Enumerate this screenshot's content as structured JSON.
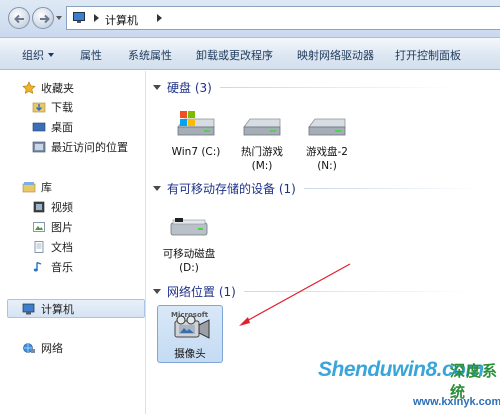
{
  "address": {
    "crumb": "计算机"
  },
  "toolbar": {
    "organize": "组织",
    "properties": "属性",
    "system_properties": "系统属性",
    "uninstall": "卸载或更改程序",
    "map_drive": "映射网络驱动器",
    "control_panel": "打开控制面板"
  },
  "nav": {
    "favorites": "收藏夹",
    "downloads": "下载",
    "desktop": "桌面",
    "recent": "最近访问的位置",
    "libraries": "库",
    "videos": "视频",
    "pictures": "图片",
    "documents": "文档",
    "music": "音乐",
    "computer": "计算机",
    "network": "网络"
  },
  "groups": {
    "hdd": "硬盘 (3)",
    "removable": "有可移动存储的设备 (1)",
    "netloc": "网络位置 (1)"
  },
  "drives": [
    {
      "name": "Win7 (C:)",
      "line2": ""
    },
    {
      "name": "热门游戏",
      "line2": "(M:)"
    },
    {
      "name": "游戏盘-2",
      "line2": "(N:)"
    }
  ],
  "removable": {
    "name": "可移动磁盘",
    "line2": "(D:)"
  },
  "camera": {
    "name": "摄像头",
    "badge": "Microsoft"
  },
  "watermark": {
    "brand": "Shenduwin8.com",
    "cn": "深度系统",
    "url": "www.kxinyk.com"
  },
  "colors": {
    "accent": "#1e3287",
    "selection": "#d5e3f3",
    "arrow": "#e0202a"
  }
}
